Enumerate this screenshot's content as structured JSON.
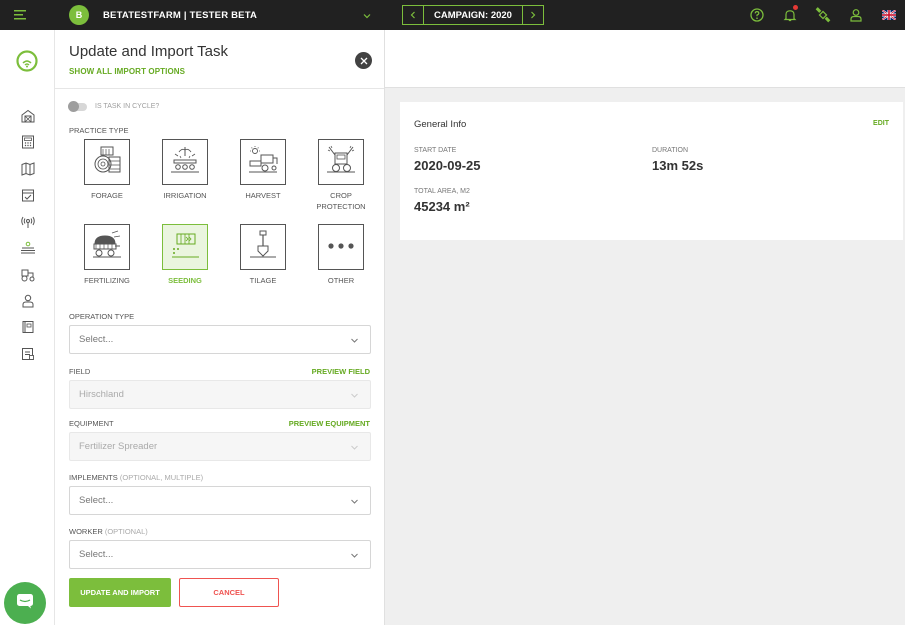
{
  "topbar": {
    "farm_initial": "B",
    "farm_name": "BETATESTFARM | TESTER BETA",
    "campaign_label": "CAMPAIGN: 2020",
    "icons": [
      "menu-icon",
      "chevron-down-icon",
      "chevron-left-icon",
      "chevron-right-icon",
      "help-icon",
      "bell-icon",
      "satellite-icon",
      "user-icon",
      "uk-flag-icon"
    ]
  },
  "sidebar": {
    "icons": [
      "logo-icon",
      "barn-icon",
      "calculator-icon",
      "map-icon",
      "calendar-icon",
      "sensor-icon",
      "field-icon",
      "tractor-icon",
      "worker-icon",
      "book-icon",
      "report-icon",
      "chat-icon"
    ]
  },
  "panel": {
    "title": "Update and Import Task",
    "show_all": "SHOW ALL IMPORT OPTIONS",
    "cycle_label": "IS TASK IN CYCLE?",
    "practice_type_label": "PRACTICE TYPE",
    "practices": [
      {
        "label": "FORAGE"
      },
      {
        "label": "IRRIGATION"
      },
      {
        "label": "HARVEST"
      },
      {
        "label": "CROP PROTECTION"
      },
      {
        "label": "FERTILIZING"
      },
      {
        "label": "SEEDING"
      },
      {
        "label": "TILAGE"
      },
      {
        "label": "OTHER"
      }
    ],
    "operation_type_label": "OPERATION TYPE",
    "operation_type_value": "Select...",
    "field_label": "FIELD",
    "field_link": "PREVIEW FIELD",
    "field_value": "Hirschland",
    "equipment_label": "EQUIPMENT",
    "equipment_link": "PREVIEW EQUIPMENT",
    "equipment_value": "Fertilizer Spreader",
    "implements_label": "IMPLEMENTS",
    "implements_optional": "(OPTIONAL, MULTIPLE)",
    "implements_value": "Select...",
    "worker_label": "WORKER",
    "worker_optional": "(OPTIONAL)",
    "worker_value": "Select...",
    "submit_label": "UPDATE AND IMPORT",
    "cancel_label": "CANCEL"
  },
  "info": {
    "title": "General Info",
    "edit": "EDIT",
    "start_date_label": "START DATE",
    "start_date": "2020-09-25",
    "duration_label": "DURATION",
    "duration": "13m 52s",
    "total_area_label": "TOTAL AREA, M2",
    "total_area": "45234 m²"
  },
  "colors": {
    "accent": "#7cbe3c",
    "topbar": "#212121",
    "danger": "#ef5350"
  }
}
